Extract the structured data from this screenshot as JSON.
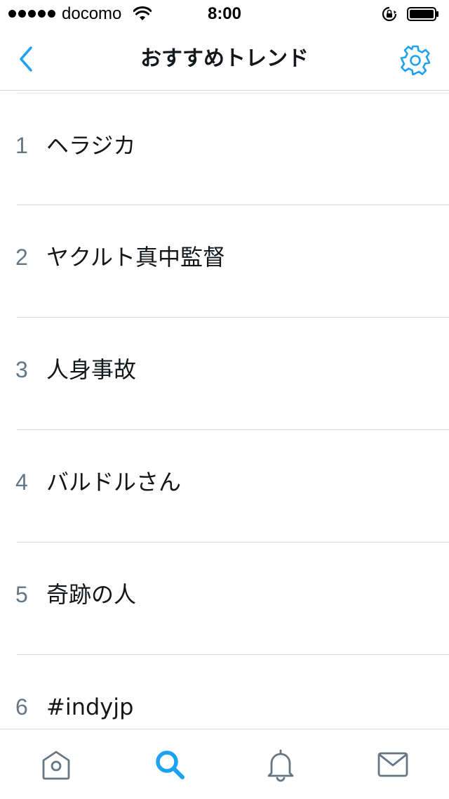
{
  "status_bar": {
    "carrier": "docomo",
    "time": "8:00",
    "signal_bars": 5,
    "icons": [
      "signal-icon",
      "wifi-icon",
      "rotation-lock-icon",
      "battery-icon"
    ]
  },
  "nav": {
    "title": "おすすめトレンド",
    "back_icon": "chevron-left-icon",
    "settings_icon": "gear-icon"
  },
  "trends": [
    {
      "rank": "1",
      "name": "ヘラジカ"
    },
    {
      "rank": "2",
      "name": "ヤクルト真中監督"
    },
    {
      "rank": "3",
      "name": "人身事故"
    },
    {
      "rank": "4",
      "name": "バルドルさん"
    },
    {
      "rank": "5",
      "name": "奇跡の人"
    },
    {
      "rank": "6",
      "name": "#indyjp"
    }
  ],
  "tab_bar": {
    "tabs": [
      {
        "name": "home",
        "icon": "home-icon",
        "active": false
      },
      {
        "name": "search",
        "icon": "search-icon",
        "active": true
      },
      {
        "name": "notifications",
        "icon": "bell-icon",
        "active": false
      },
      {
        "name": "messages",
        "icon": "mail-icon",
        "active": false
      }
    ]
  },
  "colors": {
    "accent": "#1da1f2",
    "text": "#14171a",
    "secondary_text": "#657786",
    "divider": "#d5dbdf",
    "inactive_icon": "#657786"
  }
}
